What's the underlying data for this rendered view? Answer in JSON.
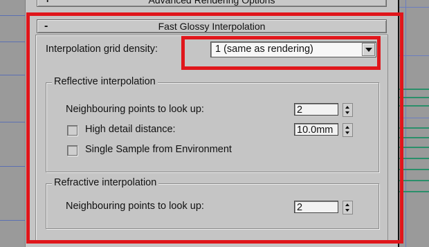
{
  "rollouts": {
    "advanced": {
      "sign": "+",
      "title": "Advanced Rendering Options"
    },
    "fast_glossy": {
      "sign": "-",
      "title": "Fast Glossy Interpolation"
    }
  },
  "grid_density": {
    "label": "Interpolation grid density:",
    "selected": "1 (same as rendering)"
  },
  "reflective": {
    "title": "Reflective interpolation",
    "neighbouring_label": "Neighbouring points to look up:",
    "neighbouring_value": "2",
    "high_detail_label": "High detail distance:",
    "high_detail_checked": false,
    "high_detail_value": "10.0mm",
    "single_sample_label": "Single Sample from Environment",
    "single_sample_checked": false
  },
  "refractive": {
    "title": "Refractive interpolation",
    "neighbouring_label": "Neighbouring points to look up:",
    "neighbouring_value": "2"
  },
  "colors": {
    "highlight": "#e0161b",
    "panel": "#c5c5c5"
  }
}
